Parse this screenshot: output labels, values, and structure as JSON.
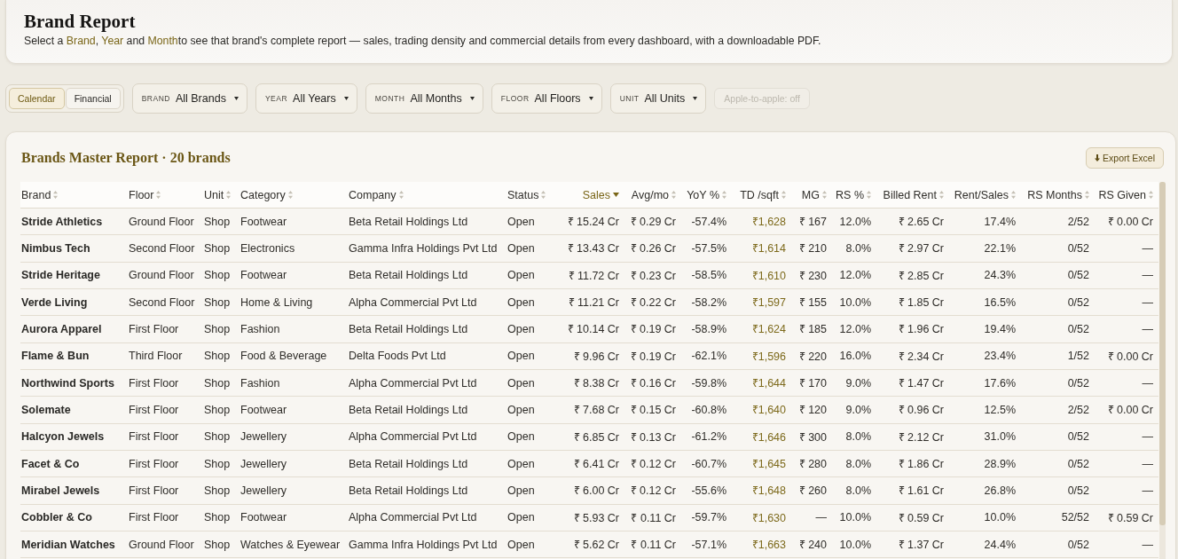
{
  "header": {
    "title": "Brand Report",
    "subtitle": "Select a **Brand**, **Year** and **Month**to see that brand's complete report — sales, trading density and commercial details from every dashboard, with a downloadable PDF."
  },
  "period_toggle": [
    {
      "label": "Calendar",
      "selected": true
    },
    {
      "label": "Financial",
      "selected": false
    }
  ],
  "filters": [
    {
      "label": "BRAND",
      "value": "All Brands"
    },
    {
      "label": "YEAR",
      "value": "All Years"
    },
    {
      "label": "MONTH",
      "value": "All Months"
    },
    {
      "label": "FLOOR",
      "value": "All Floors"
    },
    {
      "label": "UNIT",
      "value": "All Units"
    }
  ],
  "apple_to_apple": {
    "label": "Apple-to-apple: off",
    "disabled": true
  },
  "report": {
    "title": "Brands Master Report · 20 brands",
    "export_button": "Export Excel",
    "table": {
      "columns": [
        {
          "label": "Brand",
          "kind": "name",
          "sorted": false
        },
        {
          "label": "Floor",
          "kind": "text",
          "sorted": false
        },
        {
          "label": "Unit",
          "kind": "text",
          "sorted": false
        },
        {
          "label": "Category",
          "kind": "text",
          "sorted": false
        },
        {
          "label": "Company",
          "kind": "text",
          "sorted": false
        },
        {
          "label": "Status",
          "kind": "text",
          "sorted": false
        },
        {
          "label": "Sales",
          "kind": "number",
          "sorted": true
        },
        {
          "label": "Avg/mo",
          "kind": "number",
          "sorted": false
        },
        {
          "label": "YoY %",
          "kind": "number",
          "sorted": false
        },
        {
          "label": "TD /sqft",
          "kind": "highlight",
          "sorted": false
        },
        {
          "label": "MG",
          "kind": "number",
          "sorted": false
        },
        {
          "label": "RS %",
          "kind": "number",
          "sorted": false
        },
        {
          "label": "Billed Rent",
          "kind": "number",
          "sorted": false
        },
        {
          "label": "Rent/Sales",
          "kind": "number",
          "sorted": false
        },
        {
          "label": "RS Months",
          "kind": "number",
          "sorted": false
        },
        {
          "label": "RS Given",
          "kind": "number",
          "sorted": false
        }
      ],
      "rows": [
        [
          "Stride Athletics",
          "Ground Floor",
          "Shop",
          "Footwear",
          "Beta Retail Holdings Ltd",
          "Open",
          "₹ 15.24 Cr",
          "₹ 0.29 Cr",
          "-57.4%",
          "₹1,628",
          "₹ 167",
          "12.0%",
          "₹ 2.65 Cr",
          "17.4%",
          "2/52",
          "₹ 0.00 Cr"
        ],
        [
          "Nimbus Tech",
          "Second Floor",
          "Shop",
          "Electronics",
          "Gamma Infra Holdings Pvt Ltd",
          "Open",
          "₹ 13.43 Cr",
          "₹ 0.26 Cr",
          "-57.5%",
          "₹1,614",
          "₹ 210",
          "8.0%",
          "₹ 2.97 Cr",
          "22.1%",
          "0/52",
          "—"
        ],
        [
          "Stride Heritage",
          "Ground Floor",
          "Shop",
          "Footwear",
          "Beta Retail Holdings Ltd",
          "Open",
          "₹ 11.72 Cr",
          "₹ 0.23 Cr",
          "-58.5%",
          "₹1,610",
          "₹ 230",
          "12.0%",
          "₹ 2.85 Cr",
          "24.3%",
          "0/52",
          "—"
        ],
        [
          "Verde Living",
          "Second Floor",
          "Shop",
          "Home & Living",
          "Alpha Commercial Pvt Ltd",
          "Open",
          "₹ 11.21 Cr",
          "₹ 0.22 Cr",
          "-58.2%",
          "₹1,597",
          "₹ 155",
          "10.0%",
          "₹ 1.85 Cr",
          "16.5%",
          "0/52",
          "—"
        ],
        [
          "Aurora Apparel",
          "First Floor",
          "Shop",
          "Fashion",
          "Beta Retail Holdings Ltd",
          "Open",
          "₹ 10.14 Cr",
          "₹ 0.19 Cr",
          "-58.9%",
          "₹1,624",
          "₹ 185",
          "12.0%",
          "₹ 1.96 Cr",
          "19.4%",
          "0/52",
          "—"
        ],
        [
          "Flame & Bun",
          "Third Floor",
          "Shop",
          "Food & Beverage",
          "Delta Foods Pvt Ltd",
          "Open",
          "₹ 9.96 Cr",
          "₹ 0.19 Cr",
          "-62.1%",
          "₹1,596",
          "₹ 220",
          "16.0%",
          "₹ 2.34 Cr",
          "23.4%",
          "1/52",
          "₹ 0.00 Cr"
        ],
        [
          "Northwind Sports",
          "First Floor",
          "Shop",
          "Fashion",
          "Alpha Commercial Pvt Ltd",
          "Open",
          "₹ 8.38 Cr",
          "₹ 0.16 Cr",
          "-59.8%",
          "₹1,644",
          "₹ 170",
          "9.0%",
          "₹ 1.47 Cr",
          "17.6%",
          "0/52",
          "—"
        ],
        [
          "Solemate",
          "First Floor",
          "Shop",
          "Footwear",
          "Beta Retail Holdings Ltd",
          "Open",
          "₹ 7.68 Cr",
          "₹ 0.15 Cr",
          "-60.8%",
          "₹1,640",
          "₹ 120",
          "9.0%",
          "₹ 0.96 Cr",
          "12.5%",
          "2/52",
          "₹ 0.00 Cr"
        ],
        [
          "Halcyon Jewels",
          "First Floor",
          "Shop",
          "Jewellery",
          "Alpha Commercial Pvt Ltd",
          "Open",
          "₹ 6.85 Cr",
          "₹ 0.13 Cr",
          "-61.2%",
          "₹1,646",
          "₹ 300",
          "8.0%",
          "₹ 2.12 Cr",
          "31.0%",
          "0/52",
          "—"
        ],
        [
          "Facet & Co",
          "First Floor",
          "Shop",
          "Jewellery",
          "Beta Retail Holdings Ltd",
          "Open",
          "₹ 6.41 Cr",
          "₹ 0.12 Cr",
          "-60.7%",
          "₹1,645",
          "₹ 280",
          "8.0%",
          "₹ 1.86 Cr",
          "28.9%",
          "0/52",
          "—"
        ],
        [
          "Mirabel Jewels",
          "First Floor",
          "Shop",
          "Jewellery",
          "Beta Retail Holdings Ltd",
          "Open",
          "₹ 6.00 Cr",
          "₹ 0.12 Cr",
          "-55.6%",
          "₹1,648",
          "₹ 260",
          "8.0%",
          "₹ 1.61 Cr",
          "26.8%",
          "0/52",
          "—"
        ],
        [
          "Cobbler & Co",
          "First Floor",
          "Shop",
          "Footwear",
          "Alpha Commercial Pvt Ltd",
          "Open",
          "₹ 5.93 Cr",
          "₹ 0.11 Cr",
          "-59.7%",
          "₹1,630",
          "—",
          "10.0%",
          "₹ 0.59 Cr",
          "10.0%",
          "52/52",
          "₹ 0.59 Cr"
        ],
        [
          "Meridian Watches",
          "Ground Floor",
          "Shop",
          "Watches & Eyewear",
          "Gamma Infra Holdings Pvt Ltd",
          "Open",
          "₹ 5.62 Cr",
          "₹ 0.11 Cr",
          "-57.1%",
          "₹1,663",
          "₹ 240",
          "10.0%",
          "₹ 1.37 Cr",
          "24.4%",
          "0/52",
          "—"
        ]
      ]
    }
  }
}
